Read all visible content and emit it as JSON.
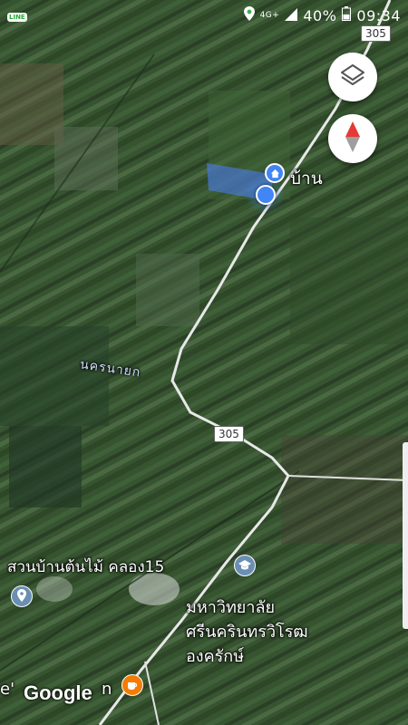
{
  "status_bar": {
    "app_badge": "LINE",
    "network": "4G+",
    "battery": "40%",
    "time": "09:34"
  },
  "map": {
    "place_home": "บ้าน",
    "district_label": "นครนายก",
    "poi_garden": "สวนบ้านต้นไม้ คลอง15",
    "poi_university_line1": "มหาวิทยาลัย",
    "poi_university_line2": "ศรีนครินทรวิโรฒ",
    "poi_university_line3": "องครักษ์",
    "poi_partial_left": "e'",
    "poi_partial_right": "n",
    "route_number_top": "305",
    "route_number_mid": "305",
    "attribution": "Google"
  },
  "controls": {
    "layers_icon": "layers-icon",
    "compass_icon": "compass-icon"
  },
  "colors": {
    "location_blue": "#4285f4",
    "road": "#e8e8e8",
    "compass_red": "#e53935",
    "poi_orange": "#f57c00",
    "poi_grey_blue": "#6b8fb3"
  }
}
